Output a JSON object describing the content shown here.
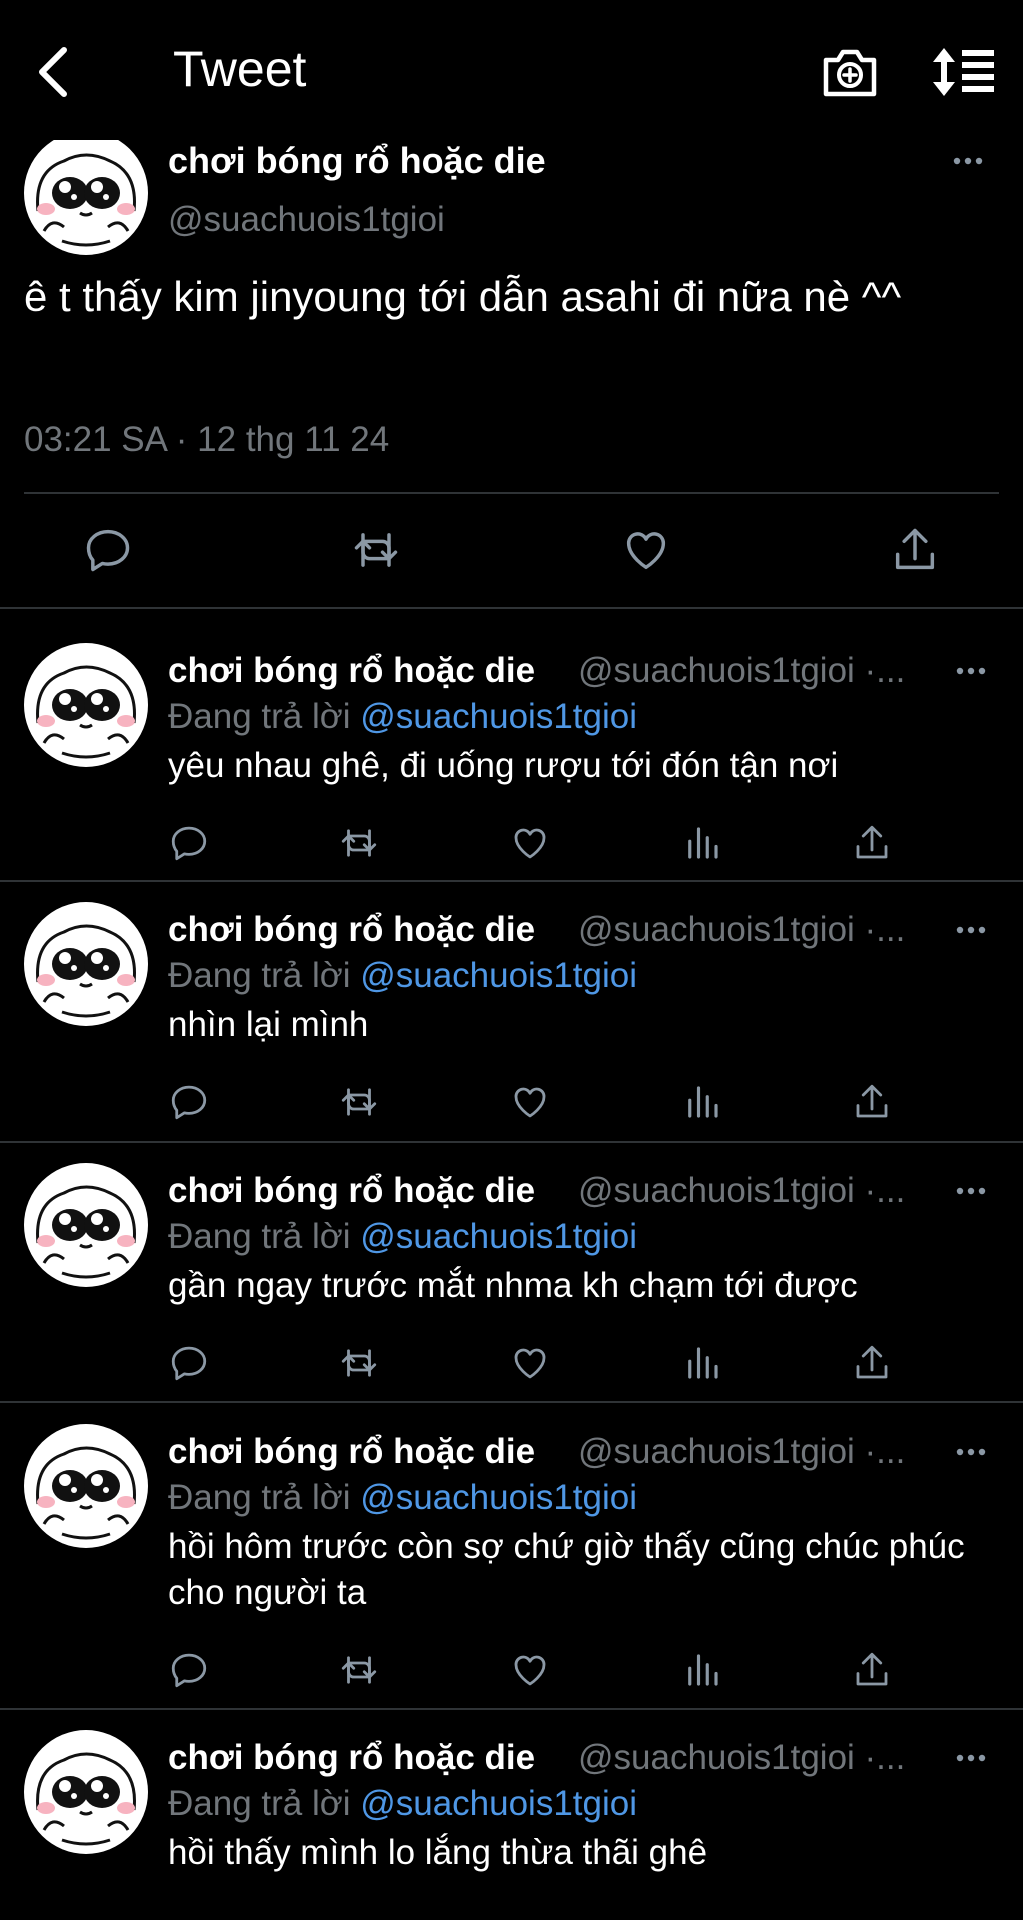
{
  "header": {
    "title": "Tweet",
    "icons": [
      "back-icon",
      "camera-plus-icon",
      "sort-icon"
    ]
  },
  "main_tweet": {
    "display_name": "chơi bóng rổ hoặc die",
    "handle": "@suachuois1tgioi",
    "text": "ê t thấy kim jinyoung tới dẫn asahi đi nữa nè ^^",
    "timestamp": "03:21 SA · 12 thg 11 24",
    "actions": [
      "reply-icon",
      "retweet-icon",
      "like-icon",
      "share-icon"
    ]
  },
  "replies": [
    {
      "display_name": "chơi bóng rổ hoặc die",
      "handle": "@suachuois1tgioi ·...",
      "replying_prefix": "Đang trả lời",
      "replying_to": "@suachuois1tgioi",
      "text": "yêu nhau ghê, đi uống rượu tới đón tận nơi"
    },
    {
      "display_name": "chơi bóng rổ hoặc die",
      "handle": "@suachuois1tgioi ·...",
      "replying_prefix": "Đang trả lời",
      "replying_to": "@suachuois1tgioi",
      "text": "nhìn lại mình"
    },
    {
      "display_name": "chơi bóng rổ hoặc die",
      "handle": "@suachuois1tgioi ·...",
      "replying_prefix": "Đang trả lời",
      "replying_to": "@suachuois1tgioi",
      "text": "gần ngay trước mắt nhma kh chạm tới được"
    },
    {
      "display_name": "chơi bóng rổ hoặc die",
      "handle": "@suachuois1tgioi ·...",
      "replying_prefix": "Đang trả lời",
      "replying_to": "@suachuois1tgioi",
      "text": "hồi hôm trước còn sợ chứ giờ thấy cũng chúc phúc cho người ta"
    },
    {
      "display_name": "chơi bóng rổ hoặc die",
      "handle": "@suachuois1tgioi ·...",
      "replying_prefix": "Đang trả lời",
      "replying_to": "@suachuois1tgioi",
      "text": "hồi thấy mình lo lắng thừa thãi ghê"
    }
  ],
  "colors": {
    "background": "#000000",
    "text": "#ffffff",
    "muted": "#71767b",
    "link": "#4f97e5",
    "divider": "#2f3336"
  }
}
